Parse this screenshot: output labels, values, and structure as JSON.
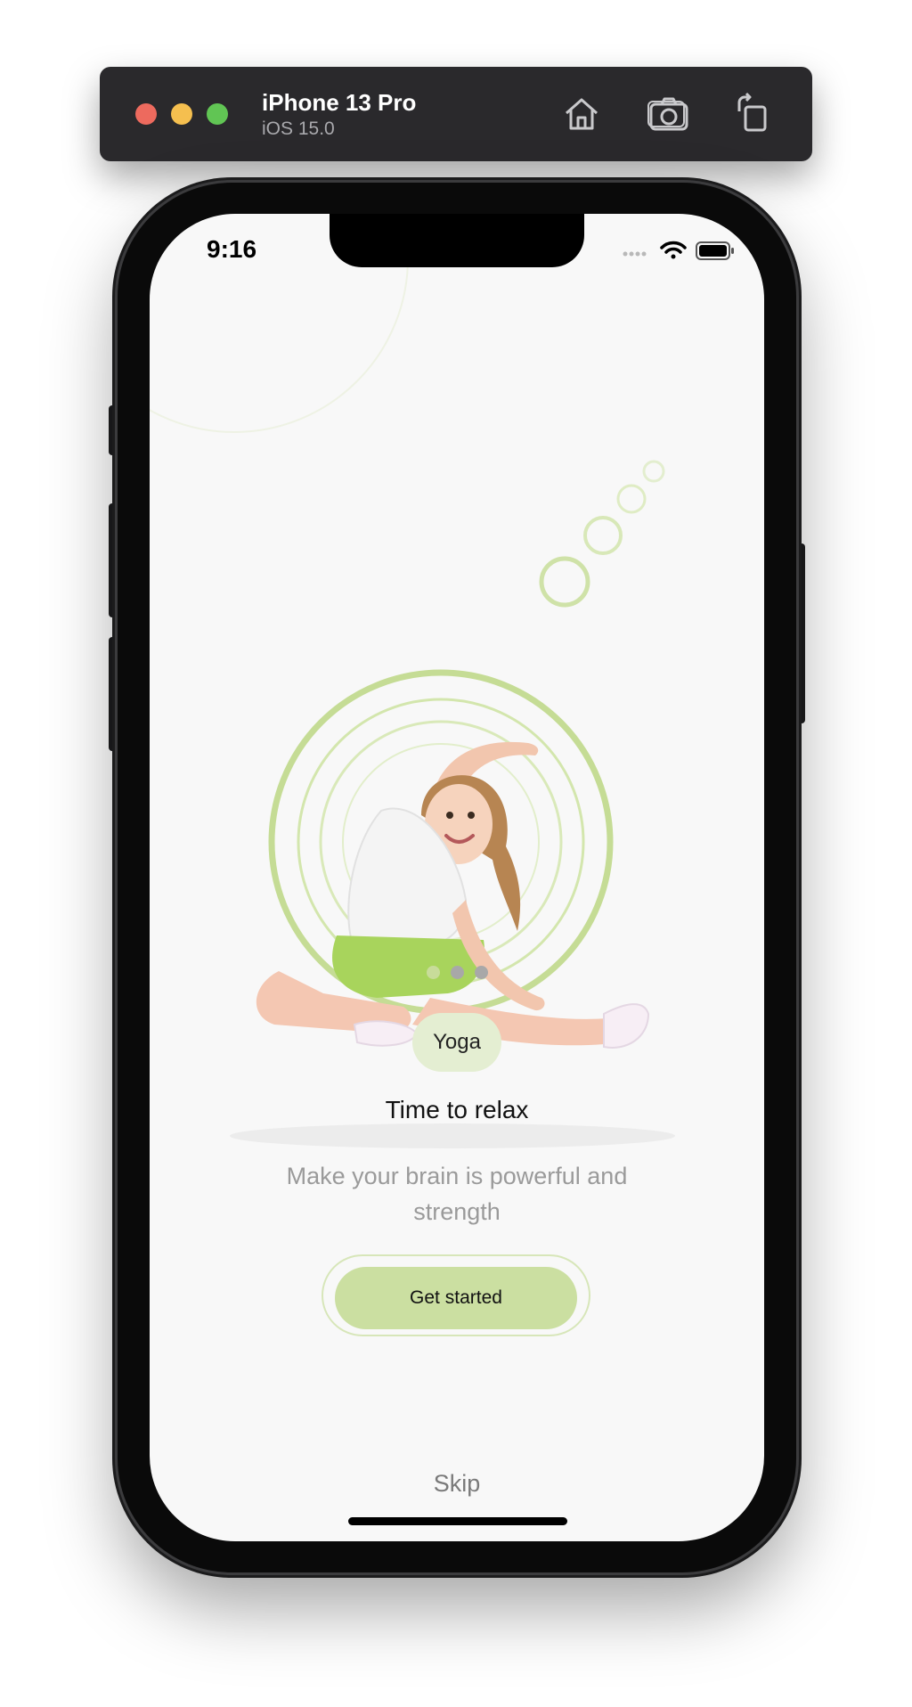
{
  "simulator": {
    "device_name": "iPhone 13 Pro",
    "os_version": "iOS 15.0",
    "toolbar_icons": [
      "home-icon",
      "screenshot-icon",
      "rotate-icon"
    ]
  },
  "status_bar": {
    "time": "9:16",
    "icons": [
      "signal-icon",
      "wifi-icon",
      "battery-icon"
    ]
  },
  "onboarding": {
    "page_indicator": {
      "count": 3,
      "active_index": 0
    },
    "category_chip": "Yoga",
    "headline": "Time to relax",
    "subtitle": "Make your brain is powerful and strength",
    "cta_label": "Get started",
    "skip_label": "Skip"
  },
  "colors": {
    "accent_green": "#cbdfa1",
    "chip_bg": "#e4eed2",
    "ring_green": "#c5dc95",
    "screen_bg": "#f8f8f8",
    "inactive_dot": "#a8a8a8"
  }
}
